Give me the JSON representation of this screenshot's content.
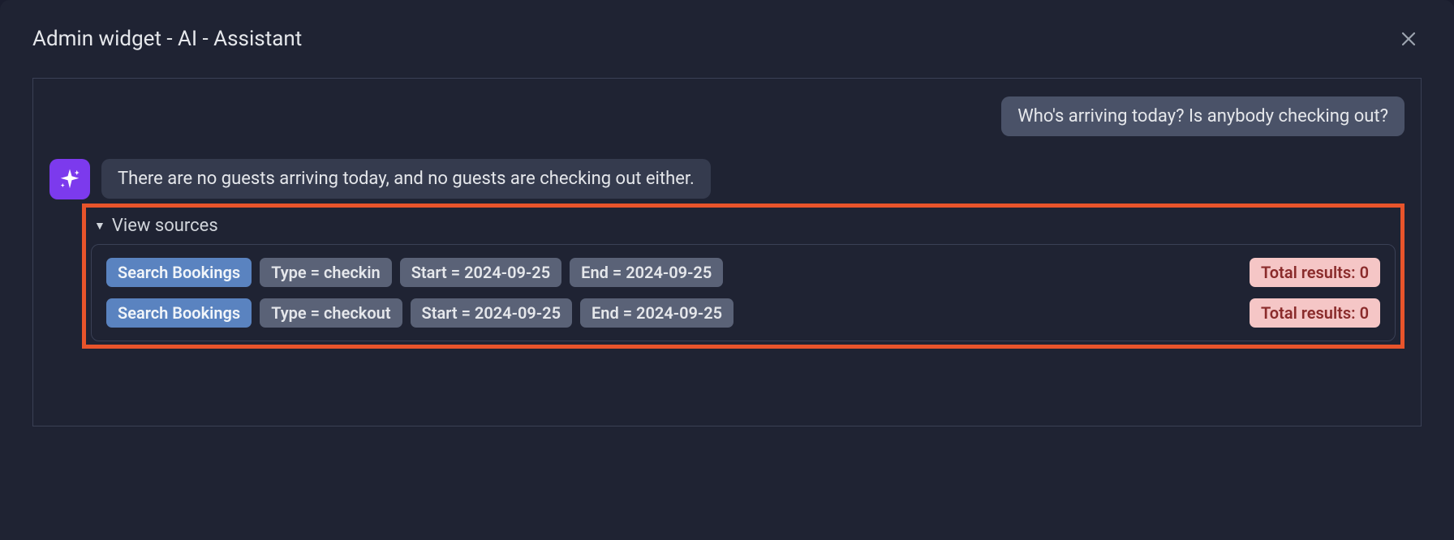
{
  "header": {
    "title": "Admin widget - AI - Assistant"
  },
  "chat": {
    "user_message": "Who's arriving today? Is anybody checking out?",
    "assistant_message": "There are no guests arriving today, and no guests are checking out either.",
    "sources": {
      "toggle_label": "View sources",
      "rows": [
        {
          "action": "Search Bookings",
          "params": [
            "Type = checkin",
            "Start = 2024-09-25",
            "End = 2024-09-25"
          ],
          "result": "Total results: 0"
        },
        {
          "action": "Search Bookings",
          "params": [
            "Type = checkout",
            "Start = 2024-09-25",
            "End = 2024-09-25"
          ],
          "result": "Total results: 0"
        }
      ]
    }
  }
}
